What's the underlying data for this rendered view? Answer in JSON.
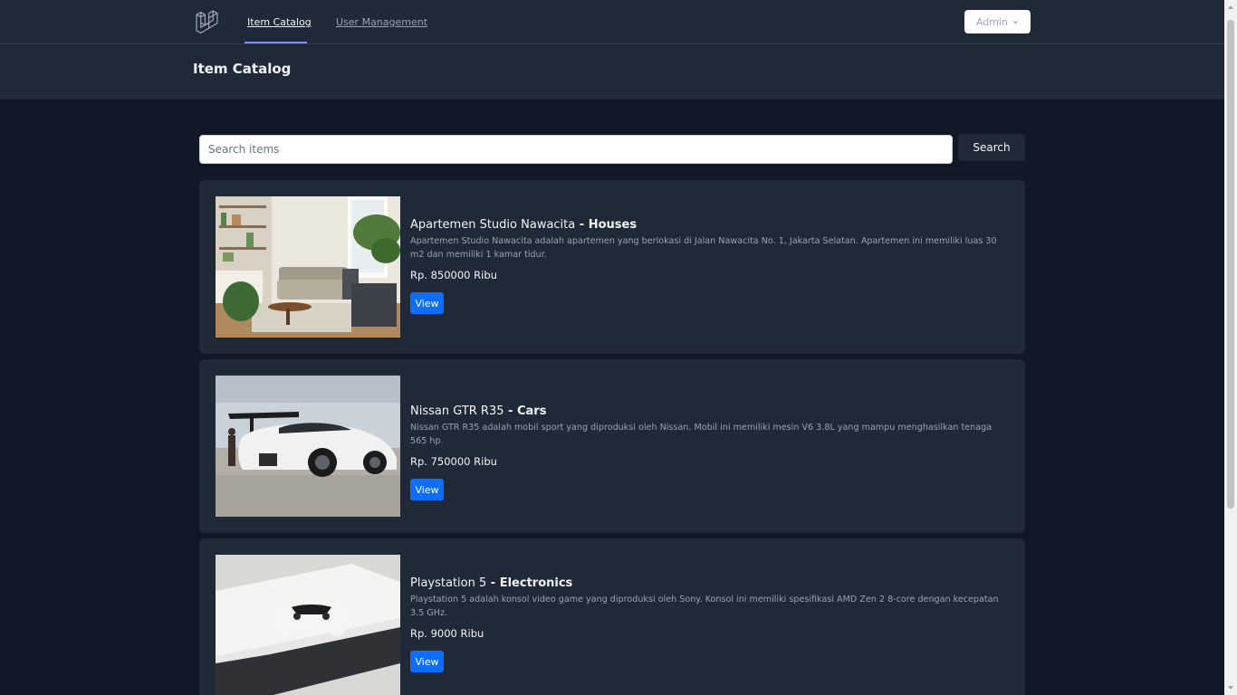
{
  "nav": {
    "logo_icon": "laravel-logo-icon",
    "links": [
      {
        "label": "Item Catalog",
        "active": true
      },
      {
        "label": "User Management",
        "active": false
      }
    ],
    "user_menu": {
      "label": "Admin",
      "icon": "chevron-down-icon"
    }
  },
  "header": {
    "title": "Item Catalog"
  },
  "search": {
    "placeholder": "Search items",
    "value": "",
    "button_label": "Search"
  },
  "items": [
    {
      "name": "Apartemen Studio Nawacita",
      "separator": " - ",
      "category": "Houses",
      "description": "Apartemen Studio Nawacita adalah apartemen yang berlokasi di Jalan Nawacita No. 1, Jakarta Selatan. Apartemen ini memiliki luas 30 m2 dan memiliki 1 kamar tidur.",
      "price": "Rp. 850000 Ribu",
      "button_label": "View",
      "image": "living-room-photo"
    },
    {
      "name": "Nissan GTR R35",
      "separator": " - ",
      "category": "Cars",
      "description": "Nissan GTR R35 adalah mobil sport yang diproduksi oleh Nissan. Mobil ini memiliki mesin V6 3.8L yang mampu menghasilkan tenaga 565 hp.",
      "price": "Rp. 750000 Ribu",
      "button_label": "View",
      "image": "white-sports-car-photo"
    },
    {
      "name": "Playstation 5",
      "separator": " - ",
      "category": "Electronics",
      "description": "Playstation 5 adalah konsol video game yang diproduksi oleh Sony. Konsol ini memiliki spesifikasi AMD Zen 2 8-core dengan kecepatan 3.5 GHz.",
      "price": "Rp. 9000 Ribu",
      "button_label": "View",
      "image": "game-console-photo"
    }
  ],
  "colors": {
    "background": "#111827",
    "panel": "#1f2937",
    "primary_button": "#0d6efd",
    "active_indicator": "#818cf8"
  }
}
